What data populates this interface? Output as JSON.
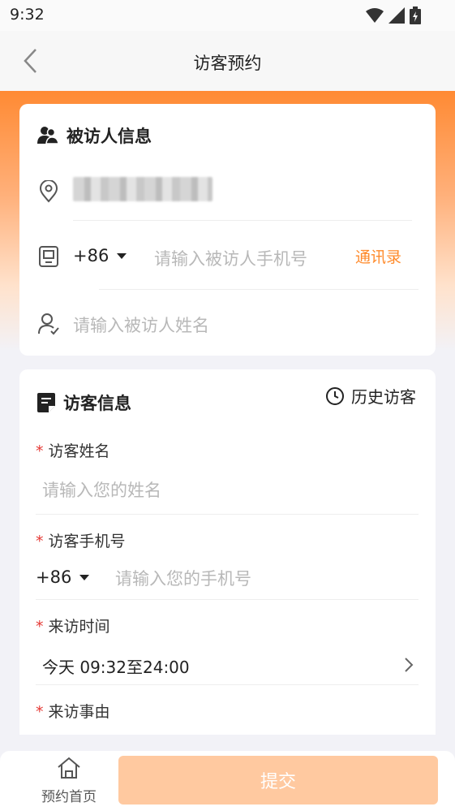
{
  "status_bar": {
    "time": "9:32"
  },
  "nav": {
    "title": "访客预约"
  },
  "visitee": {
    "section_title": "被访人信息",
    "country_code": "+86",
    "phone_placeholder": "请输入被访人手机号",
    "contacts_link": "通讯录",
    "name_placeholder": "请输入被访人姓名"
  },
  "visitor": {
    "section_title": "访客信息",
    "history_label": "历史访客",
    "name_label": "访客姓名",
    "name_placeholder": "请输入您的姓名",
    "phone_label": "访客手机号",
    "country_code": "+86",
    "phone_placeholder": "请输入您的手机号",
    "time_label": "来访时间",
    "time_value": "今天 09:32至24:00",
    "reason_label": "来访事由",
    "required_mark": "*"
  },
  "bottom": {
    "home_label": "预约首页",
    "submit_label": "提交"
  },
  "colors": {
    "accent": "#ff8a2a",
    "submit_bg": "#ffc9a0",
    "required": "#e53935"
  }
}
